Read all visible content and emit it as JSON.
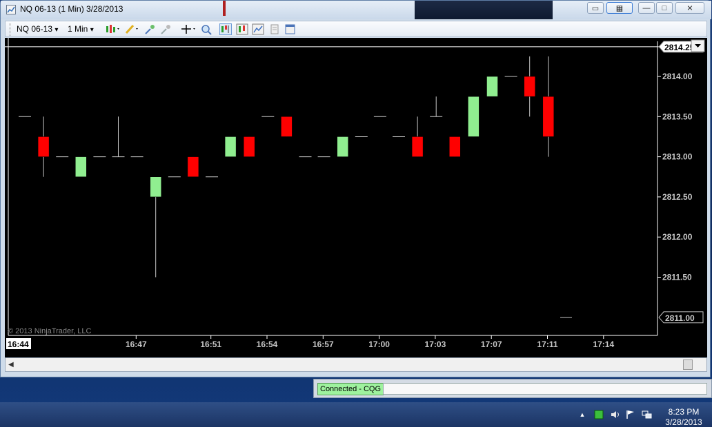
{
  "window": {
    "title": "NQ 06-13 (1 Min)  3/28/2013",
    "controls": {
      "minimize": "—",
      "maximize": "□",
      "close": "✕"
    }
  },
  "toolbar": {
    "instrument": "NQ 06-13",
    "interval": "1 Min",
    "dropdown_glyph": "▾"
  },
  "chart": {
    "copyright": "© 2013 NinjaTrader, LLC",
    "current_time_label": "16:44",
    "last_price_label": "2814.25",
    "low_marker_label": "2811.00",
    "colors": {
      "up": "#90ee90",
      "down": "#ff0000",
      "wick": "#c8c8c8",
      "axis_text": "#c8c8c8",
      "background": "#000000"
    }
  },
  "chart_data": {
    "type": "candlestick",
    "instrument": "NQ 06-13",
    "interval": "1 Min",
    "yaxis_ticks": [
      "2811.50",
      "2812.00",
      "2812.50",
      "2813.00",
      "2813.50",
      "2814.00"
    ],
    "xaxis_ticks": [
      "16:47",
      "16:51",
      "16:54",
      "16:57",
      "17:00",
      "17:03",
      "17:07",
      "17:11",
      "17:14"
    ],
    "last_price": 2814.25,
    "candles": [
      {
        "time": "16:44",
        "open": 2813.5,
        "high": 2813.5,
        "low": 2813.5,
        "close": 2813.5
      },
      {
        "time": "16:45",
        "open": 2813.25,
        "high": 2813.5,
        "low": 2812.75,
        "close": 2813.0
      },
      {
        "time": "16:46",
        "open": 2813.0,
        "high": 2813.0,
        "low": 2813.0,
        "close": 2813.0
      },
      {
        "time": "16:47",
        "open": 2812.75,
        "high": 2813.0,
        "low": 2812.75,
        "close": 2813.0
      },
      {
        "time": "16:48",
        "open": 2813.0,
        "high": 2813.0,
        "low": 2813.0,
        "close": 2813.0
      },
      {
        "time": "16:49",
        "open": 2813.0,
        "high": 2813.5,
        "low": 2813.0,
        "close": 2813.0
      },
      {
        "time": "16:50",
        "open": 2813.0,
        "high": 2813.0,
        "low": 2813.0,
        "close": 2813.0
      },
      {
        "time": "16:51",
        "open": 2812.5,
        "high": 2812.75,
        "low": 2811.5,
        "close": 2812.75
      },
      {
        "time": "16:52",
        "open": 2812.75,
        "high": 2812.75,
        "low": 2812.75,
        "close": 2812.75
      },
      {
        "time": "16:53",
        "open": 2813.0,
        "high": 2813.0,
        "low": 2812.75,
        "close": 2812.75
      },
      {
        "time": "16:54",
        "open": 2812.75,
        "high": 2812.75,
        "low": 2812.75,
        "close": 2812.75
      },
      {
        "time": "16:55",
        "open": 2813.0,
        "high": 2813.25,
        "low": 2813.0,
        "close": 2813.25
      },
      {
        "time": "16:56",
        "open": 2813.25,
        "high": 2813.25,
        "low": 2813.0,
        "close": 2813.0
      },
      {
        "time": "16:57",
        "open": 2813.5,
        "high": 2813.5,
        "low": 2813.5,
        "close": 2813.5
      },
      {
        "time": "16:58",
        "open": 2813.5,
        "high": 2813.5,
        "low": 2813.25,
        "close": 2813.25
      },
      {
        "time": "16:59",
        "open": 2813.0,
        "high": 2813.0,
        "low": 2813.0,
        "close": 2813.0
      },
      {
        "time": "17:00",
        "open": 2813.0,
        "high": 2813.0,
        "low": 2813.0,
        "close": 2813.0
      },
      {
        "time": "17:01",
        "open": 2813.0,
        "high": 2813.25,
        "low": 2813.0,
        "close": 2813.25
      },
      {
        "time": "17:02",
        "open": 2813.25,
        "high": 2813.25,
        "low": 2813.25,
        "close": 2813.25
      },
      {
        "time": "17:03",
        "open": 2813.5,
        "high": 2813.5,
        "low": 2813.5,
        "close": 2813.5
      },
      {
        "time": "17:04",
        "open": 2813.25,
        "high": 2813.25,
        "low": 2813.25,
        "close": 2813.25
      },
      {
        "time": "17:05",
        "open": 2813.25,
        "high": 2813.5,
        "low": 2813.0,
        "close": 2813.0
      },
      {
        "time": "17:06",
        "open": 2813.5,
        "high": 2813.75,
        "low": 2813.5,
        "close": 2813.5
      },
      {
        "time": "17:07",
        "open": 2813.25,
        "high": 2813.25,
        "low": 2813.0,
        "close": 2813.0
      },
      {
        "time": "17:08",
        "open": 2813.25,
        "high": 2813.75,
        "low": 2813.25,
        "close": 2813.75
      },
      {
        "time": "17:09",
        "open": 2813.75,
        "high": 2814.0,
        "low": 2813.75,
        "close": 2814.0
      },
      {
        "time": "17:10",
        "open": 2814.0,
        "high": 2814.0,
        "low": 2814.0,
        "close": 2814.0
      },
      {
        "time": "17:11",
        "open": 2814.0,
        "high": 2814.25,
        "low": 2813.5,
        "close": 2813.75
      },
      {
        "time": "17:12",
        "open": 2813.75,
        "high": 2814.25,
        "low": 2813.0,
        "close": 2813.25
      }
    ],
    "low_marker": 2811.0
  },
  "statusbar": {
    "connection": "Connected - CQG"
  },
  "taskbar": {
    "time": "8:23 PM",
    "date": "3/28/2013",
    "tray_icons": [
      "show-hidden-icons-arrow",
      "ninjatrader-tray-icon",
      "volume-icon",
      "action-center-flag-icon",
      "network-icon"
    ]
  }
}
